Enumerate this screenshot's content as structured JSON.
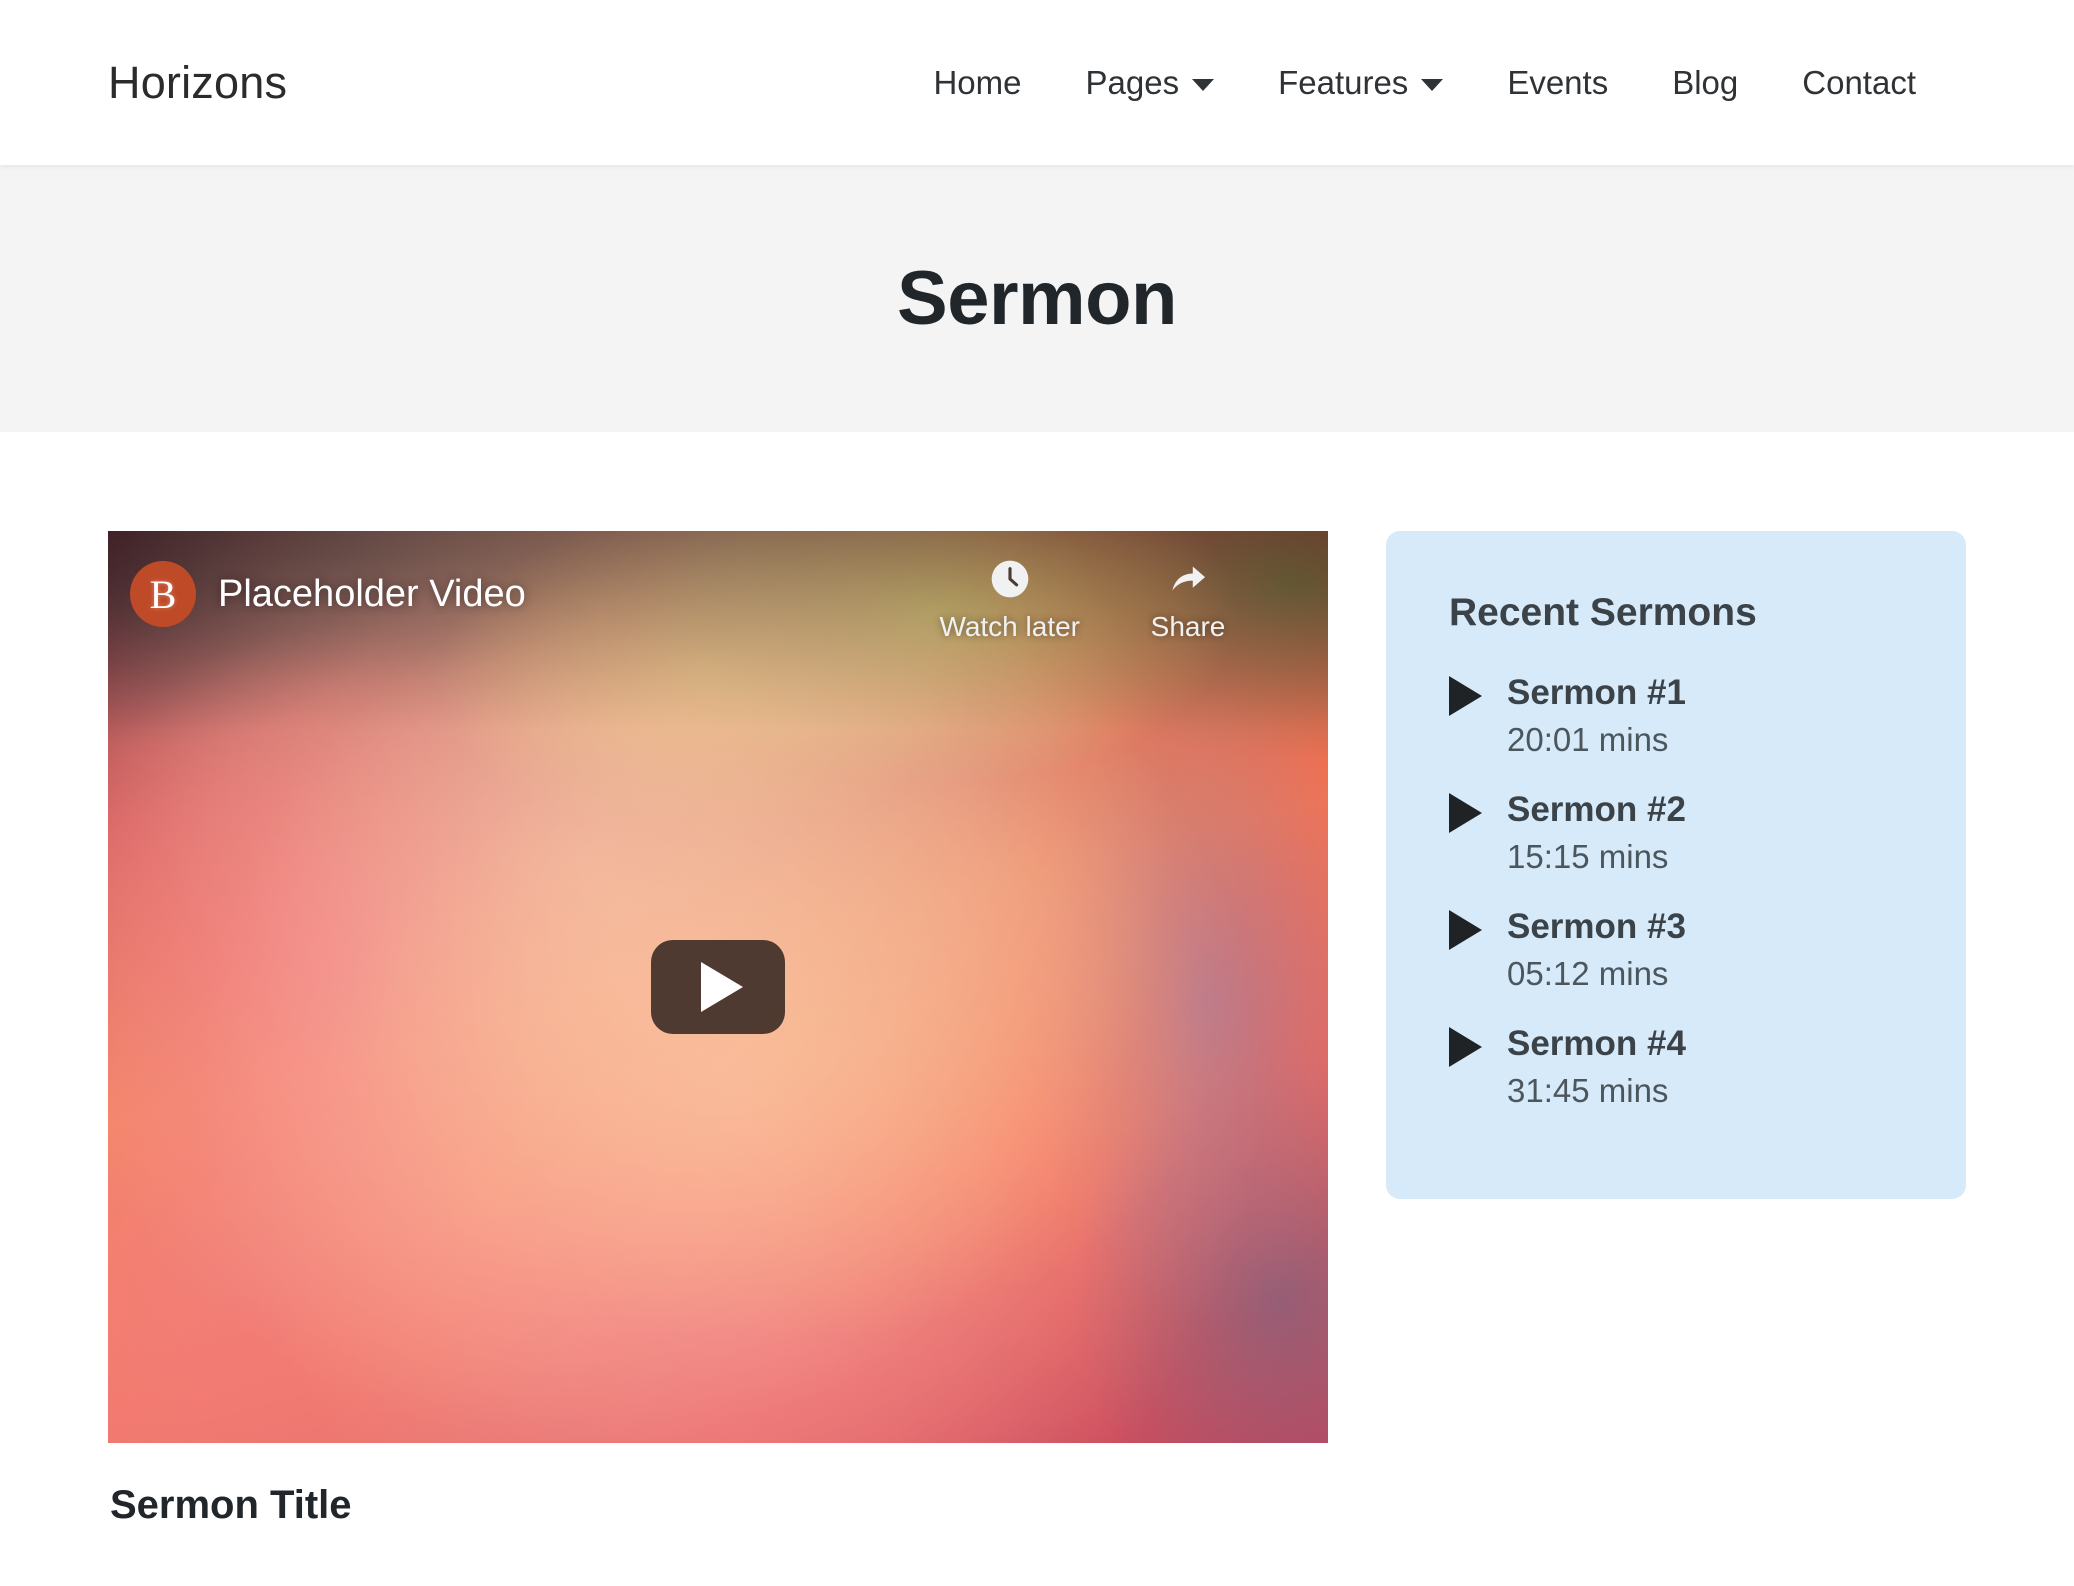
{
  "navbar": {
    "brand": "Horizons",
    "items": [
      {
        "label": "Home",
        "has_dropdown": false
      },
      {
        "label": "Pages",
        "has_dropdown": true,
        "icon": "chevron-down-icon"
      },
      {
        "label": "Features",
        "has_dropdown": true,
        "icon": "chevron-down-icon"
      },
      {
        "label": "Events",
        "has_dropdown": false
      },
      {
        "label": "Blog",
        "has_dropdown": false
      },
      {
        "label": "Contact",
        "has_dropdown": false
      }
    ]
  },
  "hero": {
    "title": "Sermon",
    "background_color": "#f4f4f5"
  },
  "video": {
    "channel_initial": "B",
    "avatar_color": "#bf4a27",
    "title": "Placeholder Video",
    "actions": [
      {
        "label": "Watch later",
        "icon": "clock-icon"
      },
      {
        "label": "Share",
        "icon": "share-arrow-icon"
      }
    ],
    "play_button_icon": "play-icon",
    "caption": "Sermon Title"
  },
  "sidebar": {
    "heading": "Recent Sermons",
    "background_color": "#d7eafa",
    "sermons": [
      {
        "name": "Sermon #1",
        "duration": "20:01 mins",
        "icon": "play-icon"
      },
      {
        "name": "Sermon #2",
        "duration": "15:15 mins",
        "icon": "play-icon"
      },
      {
        "name": "Sermon #3",
        "duration": "05:12 mins",
        "icon": "play-icon"
      },
      {
        "name": "Sermon #4",
        "duration": "31:45 mins",
        "icon": "play-icon"
      }
    ]
  }
}
